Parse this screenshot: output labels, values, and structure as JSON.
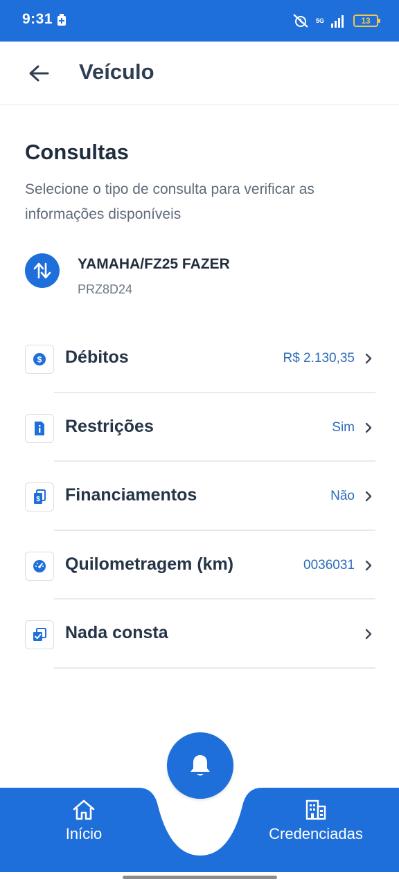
{
  "status_bar": {
    "time": "9:31",
    "network": "5G",
    "battery": "13"
  },
  "app_bar": {
    "title": "Veículo"
  },
  "section": {
    "title": "Consultas",
    "description": "Selecione o tipo de consulta para verificar as informações disponíveis"
  },
  "vehicle": {
    "name": "YAMAHA/FZ25 FAZER",
    "plate": "PRZ8D24"
  },
  "items": [
    {
      "label": "Débitos",
      "value": "R$ 2.130,35",
      "icon": "dollar-coin-icon"
    },
    {
      "label": "Restrições",
      "value": "Sim",
      "icon": "info-document-icon"
    },
    {
      "label": "Financiamentos",
      "value": "Não",
      "icon": "financing-document-icon"
    },
    {
      "label": "Quilometragem (km)",
      "value": "0036031",
      "icon": "speedometer-icon"
    },
    {
      "label": "Nada consta",
      "value": "",
      "icon": "checked-documents-icon"
    }
  ],
  "bottom_nav": {
    "home_label": "Início",
    "credentialed_label": "Credenciadas"
  },
  "colors": {
    "primary": "#1e6fd9",
    "value_text": "#2c6bb8",
    "title_text": "#1f2d3d",
    "secondary_text": "#5f6b7a"
  }
}
